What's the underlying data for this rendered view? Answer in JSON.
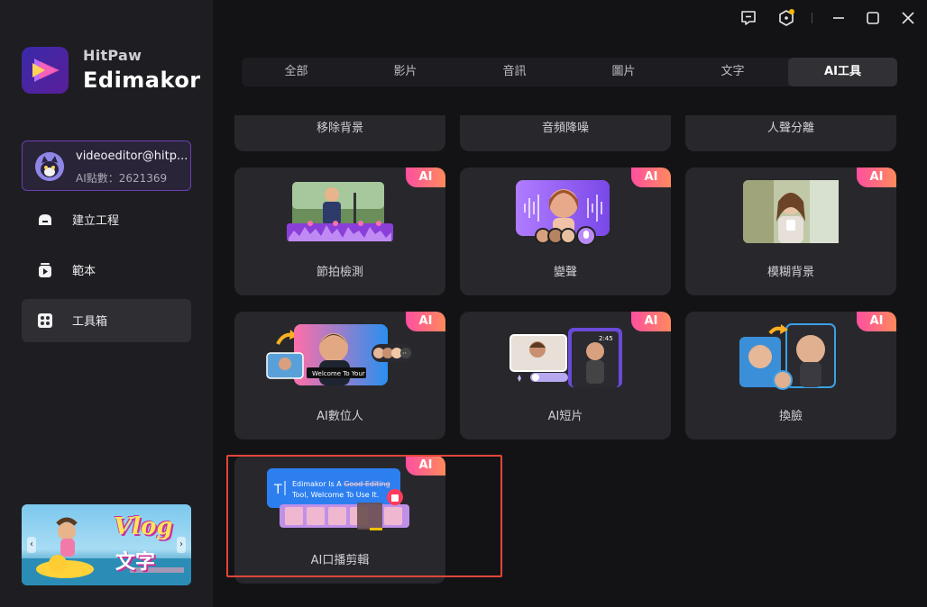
{
  "brand": {
    "top": "HitPaw",
    "main": "Edimakor"
  },
  "user": {
    "name": "videoeditor@hitp...",
    "points": "AI點數：2621369"
  },
  "nav": [
    {
      "label": "建立工程",
      "icon": "home-icon"
    },
    {
      "label": "範本",
      "icon": "template-icon"
    },
    {
      "label": "工具箱",
      "icon": "toolbox-icon"
    }
  ],
  "banner": {
    "title": "Vlog",
    "subtitle": "文字"
  },
  "tabs": [
    {
      "label": "全部"
    },
    {
      "label": "影片"
    },
    {
      "label": "音訊"
    },
    {
      "label": "圖片"
    },
    {
      "label": "文字"
    },
    {
      "label": "AI工具"
    }
  ],
  "active_tab": "AI工具",
  "tools_partial": [
    {
      "label": "移除背景"
    },
    {
      "label": "音頻降噪"
    },
    {
      "label": "人聲分離"
    }
  ],
  "tools": [
    {
      "label": "節拍檢測",
      "badge": "AI"
    },
    {
      "label": "變聲",
      "badge": "AI"
    },
    {
      "label": "模糊背景",
      "badge": "AI"
    },
    {
      "label": "AI數位人",
      "badge": "AI"
    },
    {
      "label": "AI短片",
      "badge": "AI"
    },
    {
      "label": "換臉",
      "badge": "AI"
    },
    {
      "label": "AI口播剪輯",
      "badge": "AI"
    }
  ],
  "thumb_text": {
    "digital_human": "Welcome To Your",
    "short_clip_time": "2:45",
    "edit_line1_a": "Edimakor Is A ",
    "edit_line1_b": "Good Editing",
    "edit_line2": "Tool, Welcome To Use It."
  },
  "colors": {
    "accent": "#6a3fb3",
    "ai_badge": "#ff4fa0",
    "highlight": "#e0463a",
    "active_nav": "#2e2e33"
  }
}
